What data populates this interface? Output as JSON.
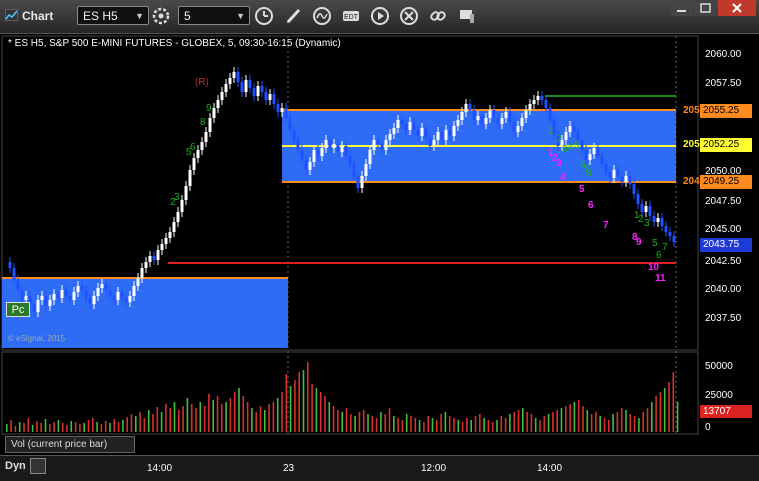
{
  "toolbar": {
    "title": "Chart",
    "symbol": "ES H5",
    "interval": "5",
    "icons": [
      "clock-icon",
      "pencil-icon",
      "cycle-icon",
      "study-icon",
      "play-icon",
      "remove-icon",
      "link-icon",
      "palette-icon"
    ]
  },
  "chart": {
    "description": "* ES H5, S&P 500 E-MINI FUTURES - GLOBEX, 5, 09:30-16:15 (Dynamic)",
    "copyright": "© eSignal, 2015",
    "pc_badge": "Pc",
    "marker_r": "(R)",
    "price_axis": [
      "2060.00",
      "2057.50",
      "2055.25",
      "2052.25",
      "2050.00",
      "2049.25",
      "2047.50",
      "2045.00",
      "2043.75",
      "2042.50",
      "2040.00",
      "2037.50"
    ],
    "current_price": "2043.75",
    "level_tags": {
      "upper": "2055.25",
      "mid": "2052.25",
      "lower": "2049.25"
    },
    "edge_labels": {
      "upper": "205",
      "mid": "205",
      "lower": "204"
    },
    "colors": {
      "up": "#ffffff",
      "down": "#2050ff",
      "zone": "#2f6cf5",
      "orange": "#ff8a1e",
      "yellow": "#ffff33",
      "red": "#e02020",
      "green": "#18b018",
      "magenta": "#ff20ff"
    }
  },
  "volume": {
    "label": "Vol (current price bar)",
    "axis": [
      "50000",
      "25000",
      "0"
    ],
    "current": "13707"
  },
  "time_axis": {
    "dyn": "Dyn",
    "labels": [
      "14:00",
      "23",
      "12:00",
      "14:00"
    ]
  },
  "counters": {
    "green_left": [
      "2",
      "3",
      "5",
      "6",
      "8",
      "9"
    ],
    "magenta_right": [
      "1",
      "2",
      "3",
      "4",
      "5",
      "6",
      "7",
      "8",
      "9",
      "10",
      "11"
    ],
    "green_right": [
      "1",
      "2",
      "3",
      "4",
      "5",
      "6",
      "7",
      "8"
    ]
  }
}
